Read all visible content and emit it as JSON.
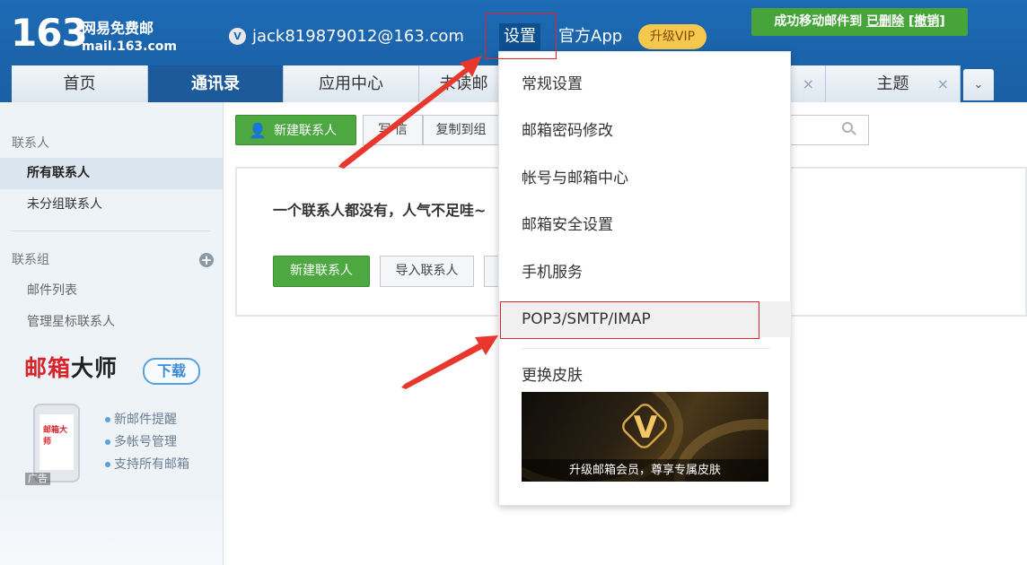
{
  "header": {
    "logo_number": "163",
    "logo_line1": "网易免费邮",
    "logo_line2": "mail.163.com",
    "account_badge": "V",
    "account": "jack819879012@163.com",
    "account_chevron": "⌄",
    "settings": "设置",
    "app": "官方App",
    "upgrade_vip": "升级VIP",
    "toast_prefix": "成功移动邮件到",
    "toast_target": "已删除",
    "toast_undo": "[撤销]"
  },
  "tabs": [
    {
      "label": "首页"
    },
    {
      "label": "通讯录"
    },
    {
      "label": "应用中心"
    },
    {
      "label": "未读邮"
    },
    {
      "label": "主题"
    }
  ],
  "tab_close": "×",
  "tab_expand": "⌄",
  "sidebar": {
    "contacts_head": "联系人",
    "all_contacts": "所有联系人",
    "ungrouped": "未分组联系人",
    "groups_head": "联系组",
    "add_group": "+",
    "mail_list": "邮件列表",
    "starred": "管理星标联系人",
    "promo_title_red": "邮箱",
    "promo_title_black": "大师",
    "promo_download": "下载",
    "promo_phone_logo": "邮箱大师",
    "features": [
      "新邮件提醒",
      "多帐号管理",
      "支持所有邮箱"
    ],
    "promo_tag": "广告"
  },
  "toolbar": {
    "new_contact": "新建联系人",
    "write": "写 信",
    "copy_to_group": "复制到组"
  },
  "empty": {
    "message": "一个联系人都没有，人气不足哇~",
    "new_contact": "新建联系人",
    "import": "导入联系人"
  },
  "dropdown": {
    "items": [
      "常规设置",
      "邮箱密码修改",
      "帐号与邮箱中心",
      "邮箱安全设置",
      "手机服务",
      "POP3/SMTP/IMAP"
    ],
    "skin_label": "更换皮肤",
    "skin_badge": "V",
    "skin_caption": "升级邮箱会员，尊享专属皮肤"
  },
  "colors": {
    "header_blue": "#1d6ab5",
    "active_tab": "#1d5a99",
    "green_button": "#4ea842",
    "annotation_red": "#e8382d",
    "vip_gold": "#f5c94e"
  }
}
